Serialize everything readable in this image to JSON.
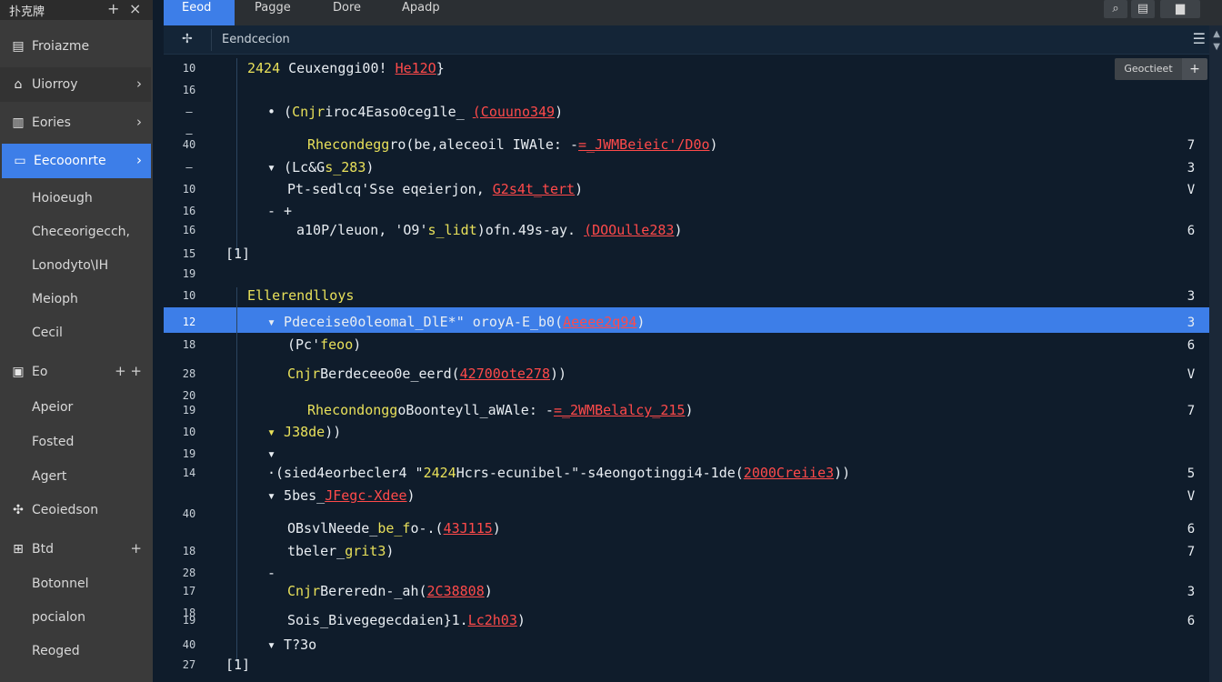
{
  "sidebar": {
    "title": "扑克牌",
    "header_buttons": [
      "+",
      "×"
    ],
    "items": [
      {
        "label": "Froiazme",
        "icon": "file-icon",
        "chevron": ""
      },
      {
        "label": "Uiorroy",
        "icon": "home-icon",
        "chevron": "›"
      },
      {
        "label": "Eories",
        "icon": "book-icon",
        "chevron": "›"
      },
      {
        "label": "Eecooonrte",
        "icon": "folder-icon",
        "chevron": "›"
      },
      {
        "label": "Hoioeugh"
      },
      {
        "label": "Checeorigecch,"
      },
      {
        "label": "Lonodyto\\IH"
      },
      {
        "label": "Meioph"
      },
      {
        "label": "Cecil"
      },
      {
        "label": "Eo",
        "icon": "image-icon",
        "chevron": "+ +"
      },
      {
        "label": "Apeior"
      },
      {
        "label": "Fosted"
      },
      {
        "label": "Agert"
      },
      {
        "label": "Ceoiedson",
        "icon": "puzzle-icon",
        "chevron": ""
      },
      {
        "label": "Btd",
        "icon": "grid-icon",
        "chevron": "+"
      },
      {
        "label": "Botonnel"
      },
      {
        "label": "pocialon"
      },
      {
        "label": "Reoged"
      }
    ]
  },
  "tabs": [
    "Eeod",
    "Pagge",
    "Dore",
    "Apadp"
  ],
  "toolbar_icons": [
    "search-icon",
    "save-icon",
    "stack-icon"
  ],
  "subheader": {
    "title": "Eendcecion"
  },
  "generate": {
    "label": "Geoctieet",
    "add": "+"
  },
  "lines": [
    {
      "gutter": "10",
      "code": [
        [
          "2424",
          "kw"
        ],
        [
          " Ceuxenggi00! ",
          ""
        ],
        [
          "He12O",
          "str"
        ],
        [
          "}",
          ""
        ]
      ],
      "right": ""
    },
    {
      "gutter": "16",
      "code": [],
      "right": ""
    },
    {
      "gutter": "—",
      "code": [
        [
          "• (",
          ""
        ],
        [
          "Cnjr",
          "kw"
        ],
        [
          "iroc4Easo0ceg1le_ ",
          ""
        ],
        [
          "(Couuno349",
          "str"
        ],
        [
          ")",
          ""
        ]
      ],
      "right": ""
    },
    {
      "gutter": "—",
      "code": [],
      "right": ""
    },
    {
      "gutter": "40",
      "code": [
        [
          "Rhecondegg",
          "kw"
        ],
        [
          "ro(be,aleceoil IWAle: -",
          ""
        ],
        [
          "=_JWMBeieic'/D0o",
          "str"
        ],
        [
          ")",
          ""
        ]
      ],
      "right": "7"
    },
    {
      "gutter": "—",
      "code": [
        [
          "▾ (Lc&G",
          ""
        ],
        [
          "s_283",
          "kw"
        ],
        [
          ")",
          ""
        ]
      ],
      "right": "3"
    },
    {
      "gutter": "10",
      "code": [
        [
          "Pt-sedlcq'Sse eqeierjon, ",
          ""
        ],
        [
          "G2s4t_tert",
          "str"
        ],
        [
          ")",
          ""
        ]
      ],
      "right": "V"
    },
    {
      "gutter": "16",
      "code": [
        [
          "- +",
          ""
        ]
      ],
      "right": ""
    },
    {
      "gutter": "16",
      "code": [
        [
          "a10P/leuon, 'O9'",
          ""
        ],
        [
          "s_lidt",
          "kw"
        ],
        [
          ")ofn.49s-ay. ",
          ""
        ],
        [
          "(DOOulle283",
          "str"
        ],
        [
          ")",
          ""
        ]
      ],
      "right": "6"
    },
    {
      "gutter": "15",
      "code": [
        [
          "[1]",
          ""
        ]
      ],
      "right": ""
    },
    {
      "gutter": "19",
      "code": [],
      "right": ""
    },
    {
      "gutter": "10",
      "code": [
        [
          "Ellerendlloys",
          "kw"
        ]
      ],
      "right": "3"
    },
    {
      "gutter": "12",
      "code": [
        [
          "▾ Pdeceise0oleomal_DlE*\" oroyA-E_b0(",
          ""
        ],
        [
          "Aeeee2q94",
          "str"
        ],
        [
          ")",
          ""
        ]
      ],
      "right": "3"
    },
    {
      "gutter": "18",
      "code": [
        [
          "(Pc'",
          ""
        ],
        [
          "feoo",
          "kw"
        ],
        [
          ")",
          ""
        ]
      ],
      "right": "6"
    },
    {
      "gutter": "28",
      "code": [
        [
          "Cnjr",
          "kw"
        ],
        [
          "Berdeceeo0e_eerd(",
          ""
        ],
        [
          "42700ote278",
          "str"
        ],
        [
          "))",
          ""
        ]
      ],
      "right": "V"
    },
    {
      "gutter": "20",
      "code": [],
      "right": ""
    },
    {
      "gutter": "19",
      "code": [
        [
          "Rhecondongg",
          "kw"
        ],
        [
          "oBoonteyll_aWAle: -",
          ""
        ],
        [
          "=_2WMBelalcy_215",
          "str"
        ],
        [
          ")",
          ""
        ]
      ],
      "right": "7"
    },
    {
      "gutter": "10",
      "code": [
        [
          "▾ J38de",
          "kw"
        ],
        [
          "))",
          ""
        ]
      ],
      "right": ""
    },
    {
      "gutter": "19",
      "code": [
        [
          "▾",
          ""
        ]
      ],
      "right": ""
    },
    {
      "gutter": "14",
      "code": [
        [
          "·(sied4eorbecler4 \"",
          ""
        ],
        [
          "2424",
          "kw"
        ],
        [
          "Hcrs-ecunibel-\"-s4eongotinggi4-1de(",
          ""
        ],
        [
          "2000Creiie3",
          "str"
        ],
        [
          "))",
          ""
        ]
      ],
      "right": "5"
    },
    {
      "gutter": "",
      "code": [
        [
          "▾ 5bes_",
          ""
        ],
        [
          "JFegc-Xdee",
          "str"
        ],
        [
          ")",
          ""
        ]
      ],
      "right": "V"
    },
    {
      "gutter": "40",
      "code": [],
      "right": ""
    },
    {
      "gutter": "",
      "code": [
        [
          "OBsvlNeede_",
          ""
        ],
        [
          "be_f",
          "kw"
        ],
        [
          "o-.(",
          ""
        ],
        [
          "43J115",
          "str"
        ],
        [
          ")",
          ""
        ]
      ],
      "right": "6"
    },
    {
      "gutter": "18",
      "code": [
        [
          "tbeler_",
          ""
        ],
        [
          "grit3",
          "kw"
        ],
        [
          ")",
          ""
        ]
      ],
      "right": "7"
    },
    {
      "gutter": "28",
      "code": [
        [
          "-",
          ""
        ]
      ],
      "right": ""
    },
    {
      "gutter": "17",
      "code": [
        [
          "Cnjr",
          "kw"
        ],
        [
          "Bereredn-_ah(",
          ""
        ],
        [
          "2C38808",
          "str"
        ],
        [
          ")",
          ""
        ]
      ],
      "right": "3"
    },
    {
      "gutter": "18",
      "code": [],
      "right": ""
    },
    {
      "gutter": "19",
      "code": [
        [
          "Sois_Bivegegecdaien}1.",
          ""
        ],
        [
          "Lc2h03",
          "str"
        ],
        [
          ")",
          ""
        ]
      ],
      "right": "6"
    },
    {
      "gutter": "40",
      "code": [
        [
          "▾ T?3o",
          ""
        ]
      ],
      "right": ""
    },
    {
      "gutter": "27",
      "code": [
        [
          "[1]",
          ""
        ]
      ],
      "right": ""
    }
  ]
}
